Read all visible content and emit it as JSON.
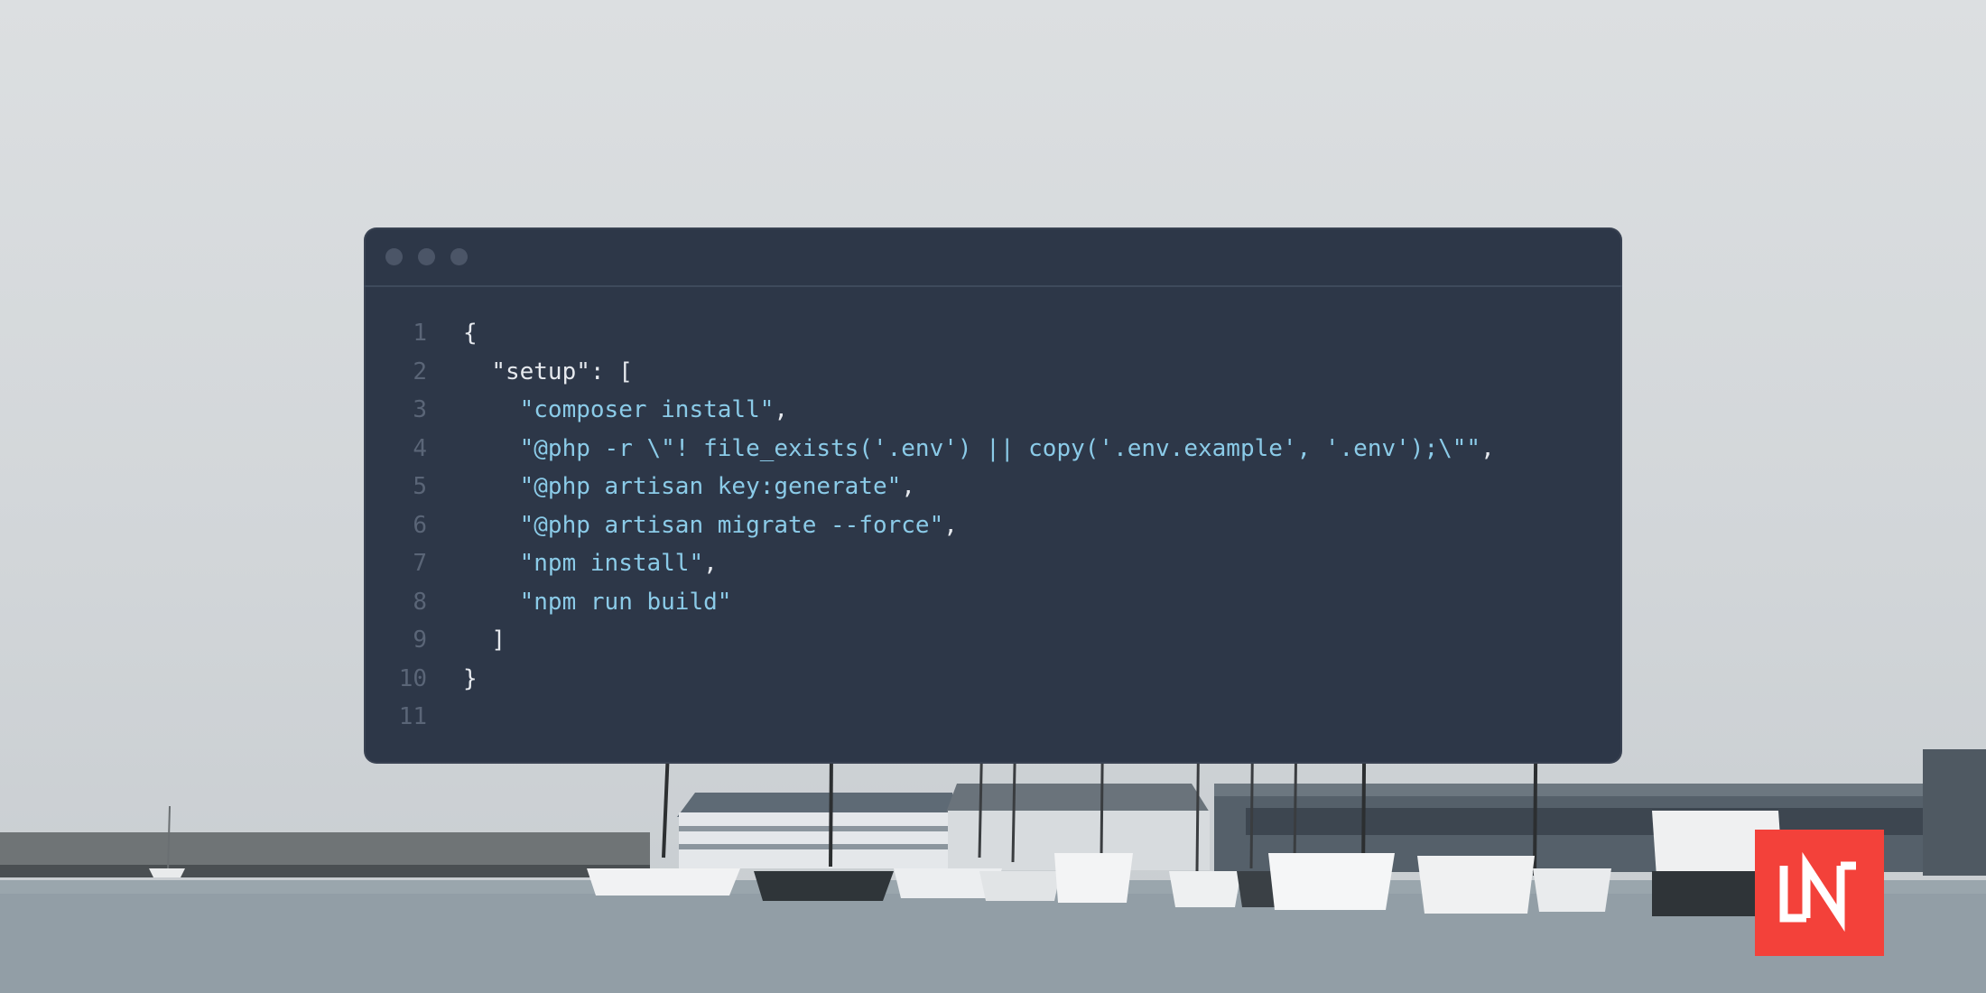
{
  "window": {
    "title_dots": [
      "close",
      "minimize",
      "maximize"
    ]
  },
  "code": {
    "line_numbers": [
      "1",
      "2",
      "3",
      "4",
      "5",
      "6",
      "7",
      "8",
      "9",
      "10",
      "11"
    ],
    "lines": [
      {
        "indent": "",
        "tokens": [
          {
            "t": "{",
            "c": "punc"
          }
        ]
      },
      {
        "indent": "  ",
        "tokens": [
          {
            "t": "\"setup\"",
            "c": "key"
          },
          {
            "t": ": [",
            "c": "punc"
          }
        ]
      },
      {
        "indent": "    ",
        "tokens": [
          {
            "t": "\"composer install\"",
            "c": "str"
          },
          {
            "t": ",",
            "c": "punc"
          }
        ]
      },
      {
        "indent": "    ",
        "tokens": [
          {
            "t": "\"@php -r \\\"! file_exists('.env') || copy('.env.example', '.env');\\\"\"",
            "c": "str"
          },
          {
            "t": ",",
            "c": "punc"
          }
        ]
      },
      {
        "indent": "    ",
        "tokens": [
          {
            "t": "\"@php artisan key:generate\"",
            "c": "str"
          },
          {
            "t": ",",
            "c": "punc"
          }
        ]
      },
      {
        "indent": "    ",
        "tokens": [
          {
            "t": "\"@php artisan migrate --force\"",
            "c": "str"
          },
          {
            "t": ",",
            "c": "punc"
          }
        ]
      },
      {
        "indent": "    ",
        "tokens": [
          {
            "t": "\"npm install\"",
            "c": "str"
          },
          {
            "t": ",",
            "c": "punc"
          }
        ]
      },
      {
        "indent": "    ",
        "tokens": [
          {
            "t": "\"npm run build\"",
            "c": "str"
          }
        ]
      },
      {
        "indent": "  ",
        "tokens": [
          {
            "t": "]",
            "c": "punc"
          }
        ]
      },
      {
        "indent": "",
        "tokens": [
          {
            "t": "}",
            "c": "punc"
          }
        ]
      },
      {
        "indent": "",
        "tokens": []
      }
    ]
  },
  "logo": {
    "text": "LN",
    "background": "#f3413a"
  },
  "colors": {
    "window_bg": "#2d3748",
    "string": "#8bcbe8",
    "punctuation": "#e6e9ee",
    "line_number": "#5a6577"
  }
}
